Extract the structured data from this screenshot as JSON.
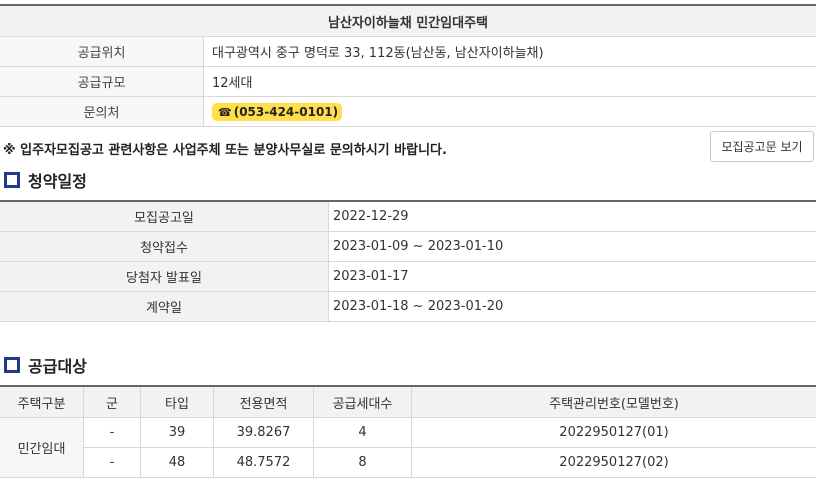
{
  "info": {
    "title": "남산자이하늘채 민간임대주택",
    "rows": [
      {
        "label": "공급위치",
        "value": "대구광역시 중구 명덕로 33, 112동(남산동, 남산자이하늘채)"
      },
      {
        "label": "공급규모",
        "value": "12세대"
      },
      {
        "label": "문의처",
        "value": "(053-424-0101)"
      }
    ],
    "phone_icon": "☎"
  },
  "notice": "※ 입주자모집공고 관련사항은 사업주체 또는 분양사무실로 문의하시기 바랍니다.",
  "notice_button": "모집공고문 보기",
  "schedule": {
    "heading": "청약일정",
    "rows": [
      {
        "label": "모집공고일",
        "value": "2022-12-29"
      },
      {
        "label": "청약접수",
        "value": "2023-01-09 ~ 2023-01-10"
      },
      {
        "label": "당첨자 발표일",
        "value": "2023-01-17"
      },
      {
        "label": "계약일",
        "value": "2023-01-18 ~ 2023-01-20"
      }
    ]
  },
  "supply": {
    "heading": "공급대상",
    "headers": [
      "주택구분",
      "군",
      "타입",
      "전용면적",
      "공급세대수",
      "주택관리번호(모델번호)"
    ],
    "group": "민간임대",
    "rows": [
      {
        "gun": "-",
        "type": "39",
        "area": "39.8267",
        "units": "4",
        "code": "2022950127(01)"
      },
      {
        "gun": "-",
        "type": "48",
        "area": "48.7572",
        "units": "8",
        "code": "2022950127(02)"
      }
    ]
  },
  "colors": {
    "accent": "#1e3a8a",
    "phone_bg": "#ffe04b"
  }
}
